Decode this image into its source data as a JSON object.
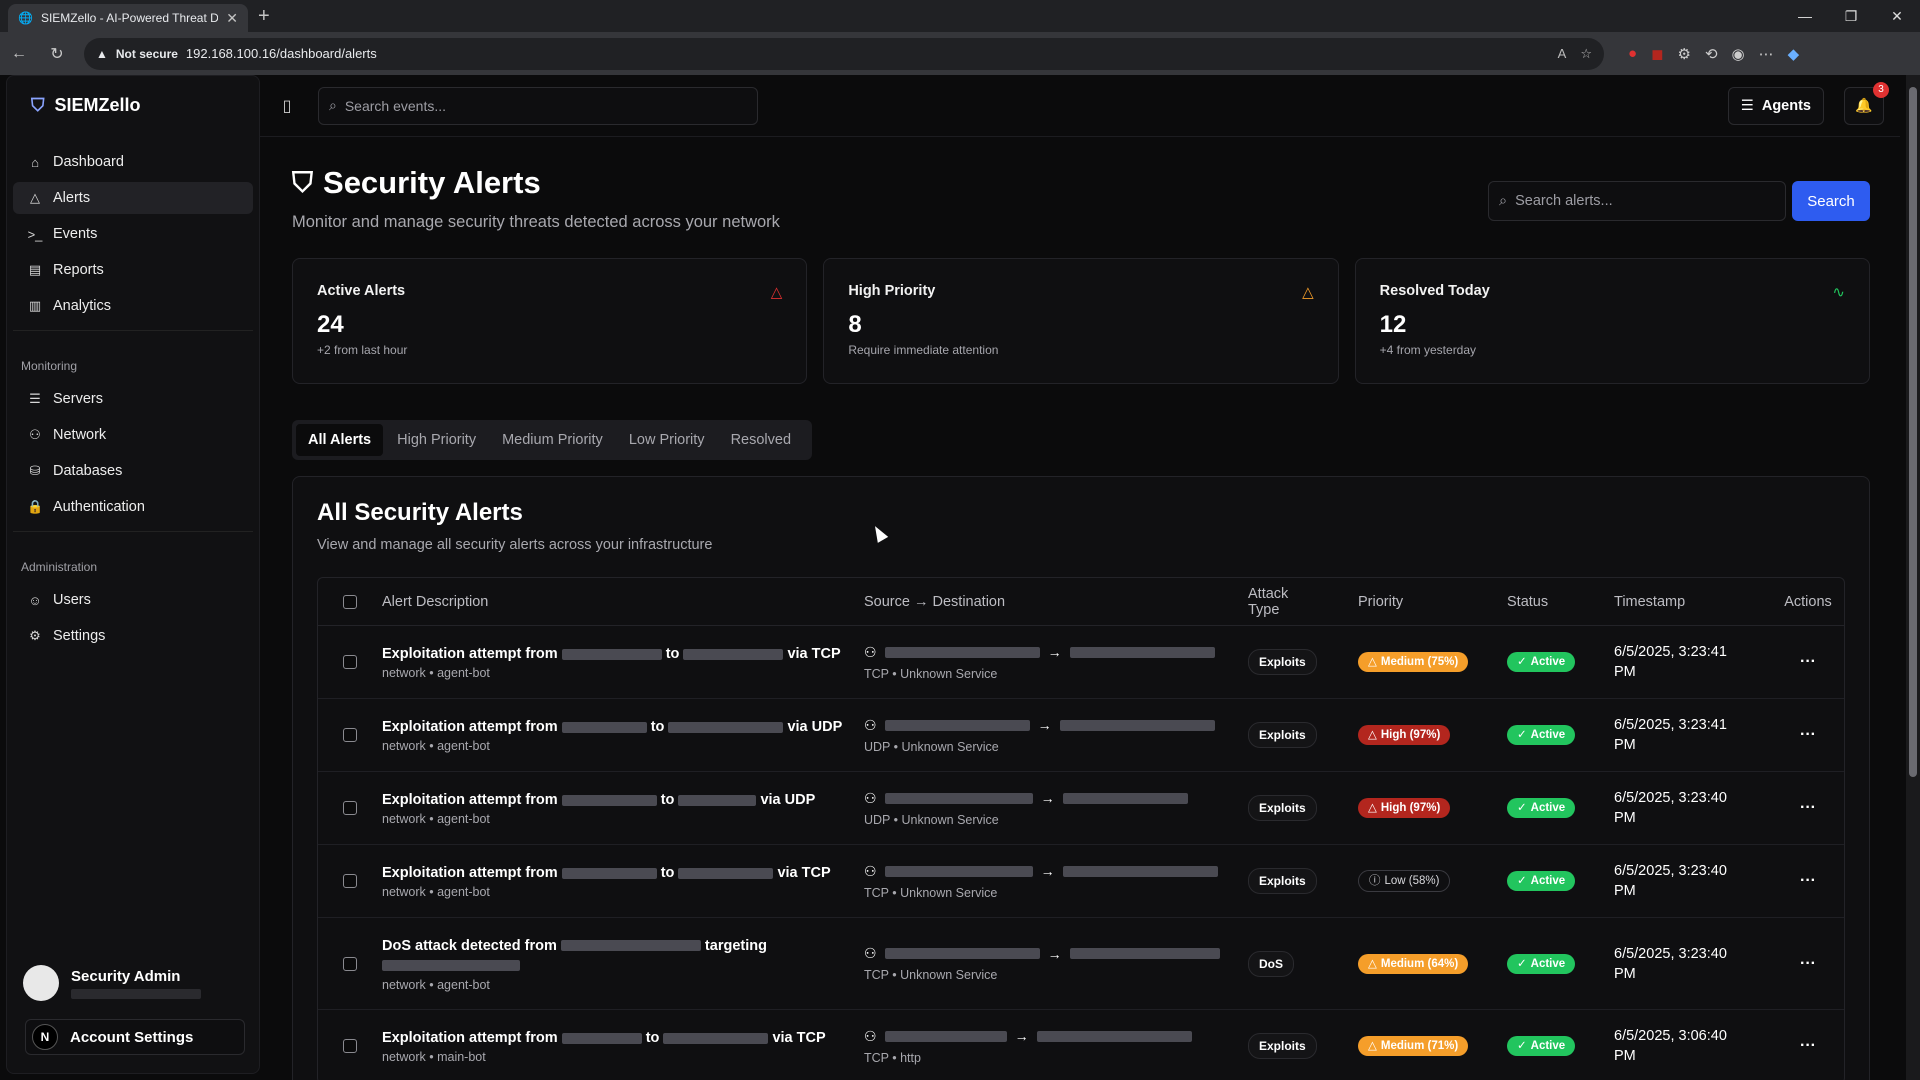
{
  "browser": {
    "tab_title": "SIEMZello - AI-Powered Threat D",
    "not_secure": "Not secure",
    "url": "192.168.100.16/dashboard/alerts"
  },
  "brand": {
    "name": "SIEMZello"
  },
  "sidebar": {
    "main": [
      {
        "label": "Dashboard",
        "icon": "home-icon"
      },
      {
        "label": "Alerts",
        "icon": "alert-triangle-icon",
        "active": true
      },
      {
        "label": "Events",
        "icon": "terminal-icon"
      },
      {
        "label": "Reports",
        "icon": "file-icon"
      },
      {
        "label": "Analytics",
        "icon": "bar-chart-icon"
      }
    ],
    "monitoring_label": "Monitoring",
    "monitoring": [
      {
        "label": "Servers",
        "icon": "server-icon"
      },
      {
        "label": "Network",
        "icon": "network-icon"
      },
      {
        "label": "Databases",
        "icon": "database-icon"
      },
      {
        "label": "Authentication",
        "icon": "lock-icon"
      }
    ],
    "administration_label": "Administration",
    "administration": [
      {
        "label": "Users",
        "icon": "users-icon"
      },
      {
        "label": "Settings",
        "icon": "gear-icon"
      }
    ],
    "user_name": "Security Admin",
    "account_settings": "Account Settings",
    "account_initial": "N"
  },
  "topbar": {
    "search_placeholder": "Search events...",
    "agents_label": "Agents",
    "notifications_count": "3"
  },
  "page": {
    "title": "Security Alerts",
    "subtitle": "Monitor and manage security threats detected across your network",
    "search_placeholder": "Search alerts...",
    "search_button": "Search"
  },
  "stats": [
    {
      "label": "Active Alerts",
      "value": "24",
      "note": "+2 from last hour",
      "icon": "alert-triangle-icon",
      "color": "#e03131"
    },
    {
      "label": "High Priority",
      "value": "8",
      "note": "Require immediate attention",
      "icon": "alert-triangle-icon",
      "color": "#f59e2a"
    },
    {
      "label": "Resolved Today",
      "value": "12",
      "note": "+4 from yesterday",
      "icon": "activity-icon",
      "color": "#22c55e"
    }
  ],
  "tabs": [
    "All Alerts",
    "High Priority",
    "Medium Priority",
    "Low Priority",
    "Resolved"
  ],
  "panel": {
    "title": "All Security Alerts",
    "subtitle": "View and manage all security alerts across your infrastructure"
  },
  "table": {
    "headers": {
      "description": "Alert Description",
      "source": "Source → Destination",
      "type_line1": "Attack",
      "type_line2": "Type",
      "priority": "Priority",
      "status": "Status",
      "timestamp": "Timestamp",
      "actions": "Actions"
    },
    "rows": [
      {
        "d1": "Exploitation attempt from",
        "d2": "to",
        "d3": "via TCP",
        "meta": "network • agent-bot",
        "proto": "TCP • Unknown Service",
        "type": "Exploits",
        "priority": "Medium (75%)",
        "pri_level": "medium",
        "status": "Active",
        "ts1": "6/5/2025, 3:23:41",
        "ts2": "PM"
      },
      {
        "d1": "Exploitation attempt from",
        "d2": "to",
        "d3": "via UDP",
        "meta": "network • agent-bot",
        "proto": "UDP • Unknown Service",
        "type": "Exploits",
        "priority": "High (97%)",
        "pri_level": "high",
        "status": "Active",
        "ts1": "6/5/2025, 3:23:41",
        "ts2": "PM"
      },
      {
        "d1": "Exploitation attempt from",
        "d2": "to",
        "d3": "via UDP",
        "meta": "network • agent-bot",
        "proto": "UDP • Unknown Service",
        "type": "Exploits",
        "priority": "High (97%)",
        "pri_level": "high",
        "status": "Active",
        "ts1": "6/5/2025, 3:23:40",
        "ts2": "PM"
      },
      {
        "d1": "Exploitation attempt from",
        "d2": "to",
        "d3": "via TCP",
        "meta": "network • agent-bot",
        "proto": "TCP • Unknown Service",
        "type": "Exploits",
        "priority": "Low (58%)",
        "pri_level": "low",
        "status": "Active",
        "ts1": "6/5/2025, 3:23:40",
        "ts2": "PM"
      },
      {
        "d1": "DoS attack detected from",
        "d2": "targeting",
        "d3": "",
        "meta": "network • agent-bot",
        "proto": "TCP • Unknown Service",
        "type": "DoS",
        "priority": "Medium (64%)",
        "pri_level": "medium",
        "status": "Active",
        "ts1": "6/5/2025, 3:23:40",
        "ts2": "PM"
      },
      {
        "d1": "Exploitation attempt from",
        "d2": "to",
        "d3": "via TCP",
        "meta": "network • main-bot",
        "proto": "TCP • http",
        "type": "Exploits",
        "priority": "Medium (71%)",
        "pri_level": "medium",
        "status": "Active",
        "ts1": "6/5/2025, 3:06:40",
        "ts2": "PM"
      }
    ]
  }
}
